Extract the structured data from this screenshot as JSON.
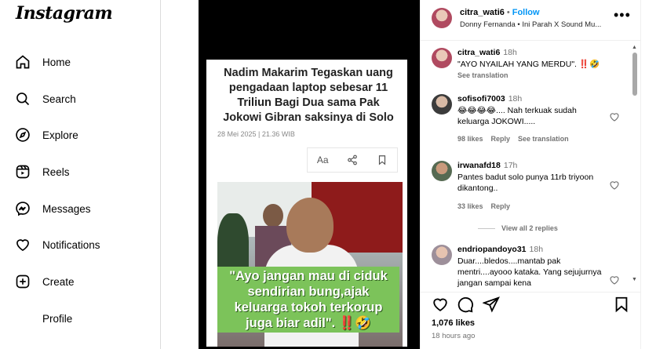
{
  "app": {
    "logo": "Instagram"
  },
  "nav": {
    "items": [
      {
        "label": "Home",
        "icon": "home-icon"
      },
      {
        "label": "Search",
        "icon": "search-icon"
      },
      {
        "label": "Explore",
        "icon": "compass-icon"
      },
      {
        "label": "Reels",
        "icon": "reels-icon"
      },
      {
        "label": "Messages",
        "icon": "messenger-icon"
      },
      {
        "label": "Notifications",
        "icon": "heart-icon"
      },
      {
        "label": "Create",
        "icon": "plus-square-icon"
      },
      {
        "label": "Profile",
        "icon": "avatar"
      }
    ]
  },
  "post": {
    "headline": "Nadim Makarim Tegaskan uang pengadaan laptop sebesar 11 Triliun Bagi Dua sama Pak Jokowi Gibran saksinya di Solo",
    "date": "28 Mei 2025 | 21.36 WIB",
    "toolbar_text_size": "Aa",
    "caption": "\"Ayo jangan mau di ciduk sendirian bung,ajak keluarga tokoh terkorup juga biar adil\". ‼️🤣"
  },
  "header": {
    "username": "citra_wati6",
    "separator": "•",
    "follow": "Follow",
    "audio": "Donny Fernanda • Ini Parah X Sound Mu...",
    "more": "•••"
  },
  "comments": [
    {
      "user": "citra_wati6",
      "time": "18h",
      "text": "\"AYO NYAILAH YANG MERDU\". ‼️🤣",
      "meta": [
        "See translation"
      ]
    },
    {
      "user": "sofisofi7003",
      "time": "18h",
      "text": "😂😂😂😂.... Nah terkuak sudah keluarga JOKOWI.....",
      "meta": [
        "98 likes",
        "Reply",
        "See translation"
      ]
    },
    {
      "user": "irwanafd18",
      "time": "17h",
      "text": "Pantes badut solo punya 11rb triyoon dikantong..",
      "meta": [
        "33 likes",
        "Reply"
      ],
      "view_replies": "View all 2 replies"
    },
    {
      "user": "endriopandoyo31",
      "time": "18h",
      "text": "Duar....bledos....mantab pak mentri....ayooo kataka. Yang sejujurnya jangan sampai kena",
      "meta": []
    }
  ],
  "footer": {
    "likes": "1,076 likes",
    "ago": "18 hours ago"
  },
  "colors": {
    "accent": "#0095f6",
    "caption_bg": "#7cc35a"
  }
}
